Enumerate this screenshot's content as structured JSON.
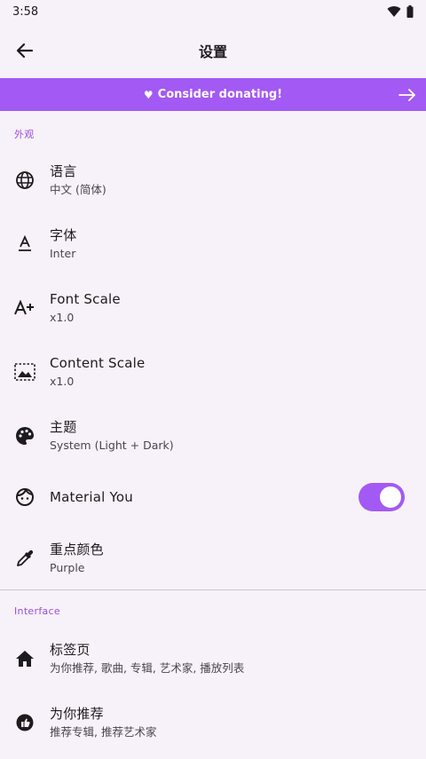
{
  "status": {
    "time": "3:58",
    "icons": [
      "wifi-icon",
      "battery-icon"
    ]
  },
  "app_bar": {
    "title": "设置",
    "back_icon": "arrow-back-icon"
  },
  "donate": {
    "label": "Consider donating!",
    "heart": "♥",
    "arrow_icon": "arrow-forward-icon"
  },
  "colors": {
    "accent": "#a359f4",
    "section_header": "#9a4fe0",
    "background": "#f7f2fa"
  },
  "sections": [
    {
      "header": "外观",
      "items": [
        {
          "icon": "globe-icon",
          "title": "语言",
          "subtitle": "中文 (简体)"
        },
        {
          "icon": "font-icon",
          "title": "字体",
          "subtitle": "Inter"
        },
        {
          "icon": "font-scale-icon",
          "title": "Font Scale",
          "subtitle": "x1.0"
        },
        {
          "icon": "content-scale-icon",
          "title": "Content Scale",
          "subtitle": "x1.0"
        },
        {
          "icon": "palette-icon",
          "title": "主题",
          "subtitle": "System (Light + Dark)"
        },
        {
          "icon": "face-icon",
          "title": "Material You",
          "toggle_on": true
        },
        {
          "icon": "eyedropper-icon",
          "title": "重点颜色",
          "subtitle": "Purple"
        }
      ]
    },
    {
      "header": "Interface",
      "items": [
        {
          "icon": "home-icon",
          "title": "标签页",
          "subtitle": "为你推荐, 歌曲, 专辑, 艺术家, 播放列表"
        },
        {
          "icon": "recommend-icon",
          "title": "为你推荐",
          "subtitle": "推荐专辑, 推荐艺术家"
        }
      ]
    }
  ]
}
